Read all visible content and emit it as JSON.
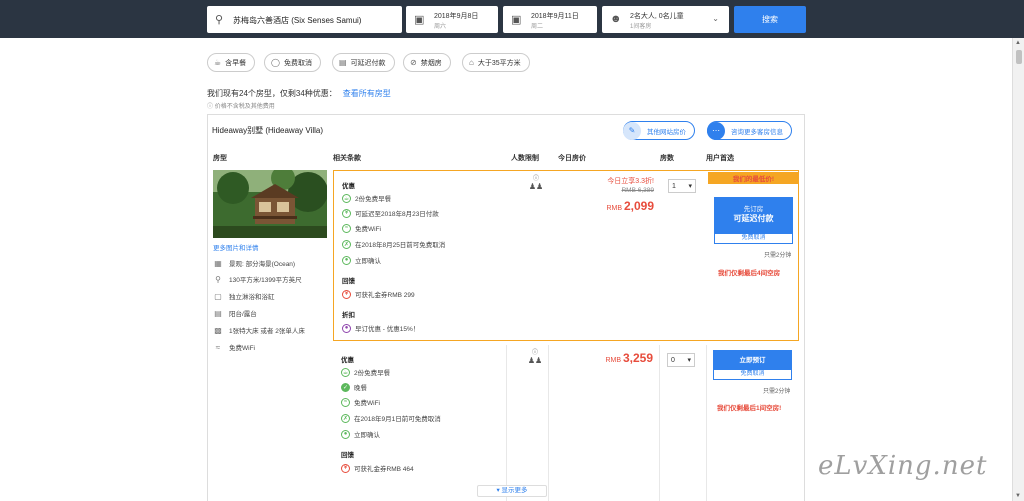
{
  "search": {
    "destination": "苏梅岛六善酒店 (Six Senses Samui)",
    "checkin_date": "2018年9月8日",
    "checkin_day": "周六",
    "checkout_date": "2018年9月11日",
    "checkout_day": "周二",
    "guests": "2名大人, 0名儿童",
    "rooms": "1间客房",
    "button": "搜索"
  },
  "filters": [
    "含早餐",
    "免费取消",
    "可延迟付款",
    "禁烟房",
    "大于35平方米"
  ],
  "summary": {
    "text": "我们现有24个房型，仅剩34种优惠：",
    "link": "查看所有房型",
    "note": "价格不含税及其他费用"
  },
  "room": {
    "title": "Hideaway别墅 (Hideaway Villa)",
    "pill_compare": "其他网站房价",
    "pill_ask": "咨询更多客房信息",
    "columns": [
      "房型",
      "相关条款",
      "人数限制",
      "今日房价",
      "房数",
      "用户首选"
    ],
    "more_link": "更多图片和详情",
    "attributes": [
      {
        "icon": "view-icon",
        "text": "景观: 部分海景(Ocean)"
      },
      {
        "icon": "area-icon",
        "text": "130平方米/1399平方英尺"
      },
      {
        "icon": "bath-icon",
        "text": "独立淋浴和浴缸"
      },
      {
        "icon": "balcony-icon",
        "text": "阳台/露台"
      },
      {
        "icon": "bed-icon",
        "text": "1张特大床 或者 2张单人床"
      },
      {
        "icon": "wifi-icon",
        "text": "免费WiFi"
      }
    ]
  },
  "offers": [
    {
      "section1": "优惠",
      "perks": [
        "2份免费早餐",
        "可延迟至2018年8月23日付款",
        "免费WiFi",
        "在2018年8月25日前可免费取消",
        "立即确认"
      ],
      "section2": "回馈",
      "cashback": "可获礼金券RMB 299",
      "section3": "折扣",
      "discount": "早订优惠 - 优惠15%！",
      "promo": "今日立享3.3折!",
      "old_price": "RMB 6,389",
      "currency": "RMB",
      "price": "2,099",
      "qty": "1",
      "best_label": "我们的最低价!",
      "book_line1": "先订房",
      "book_line2": "可延迟付款",
      "cancel_label": "免费取消",
      "timer": "只需2分钟",
      "scarce": "我们仅剩最后4间空房"
    },
    {
      "section1": "优惠",
      "perks": [
        "2份免费早餐",
        "晚餐",
        "免费WiFi",
        "在2018年9月1日前可免费取消",
        "立即确认"
      ],
      "section2": "回馈",
      "cashback": "可获礼金券RMB 464",
      "currency": "RMB",
      "price": "3,259",
      "qty": "0",
      "book_line1": "立即预订",
      "cancel_label": "免费取消",
      "timer": "只需2分钟",
      "scarce": "我们仅剩最后1间空房!"
    }
  ],
  "show_more": "显示更多",
  "watermark": "eLvXing.net",
  "colors": {
    "accent": "#2f80ed",
    "highlight": "#f5a623",
    "price": "#e74c3c",
    "topbar": "#2b3542"
  }
}
